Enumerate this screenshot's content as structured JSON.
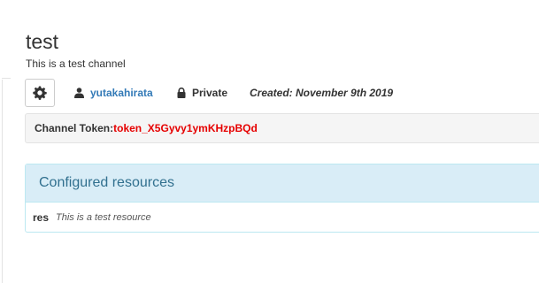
{
  "channel": {
    "title": "test",
    "description": "This is a test channel",
    "owner": "yutakahirata",
    "privacy": "Private",
    "created": "Created: November 9th 2019"
  },
  "token": {
    "label": "Channel Token:",
    "value": "token_X5Gyvy1ymKHzpBQd"
  },
  "resources_panel": {
    "heading": "Configured resources",
    "items": [
      {
        "name": "res",
        "description": "This is a test resource"
      }
    ]
  },
  "icons": {
    "settings": "gear-icon",
    "owner": "user-icon",
    "privacy": "lock-icon"
  },
  "colors": {
    "link": "#337ab7",
    "token": "#e60000",
    "panel_heading_bg": "#d9edf7",
    "panel_heading_text": "#31708f"
  }
}
